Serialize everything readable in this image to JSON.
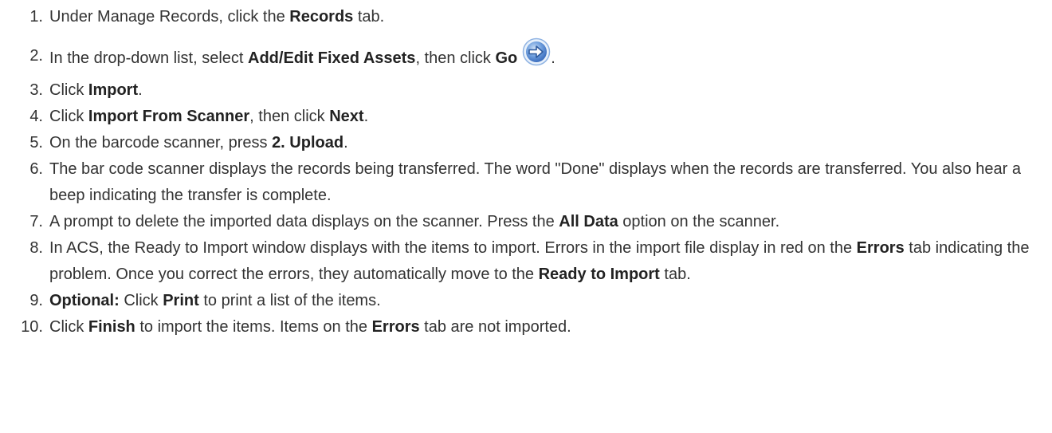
{
  "steps": [
    {
      "number": "1.",
      "parts": [
        "Under Manage Records, click the ",
        "Records",
        " tab."
      ]
    },
    {
      "number": "2.",
      "parts": [
        "In the drop-down list, select ",
        "Add/Edit Fixed Assets",
        ", then click ",
        "Go",
        "."
      ],
      "icon": "go-arrow-icon"
    },
    {
      "number": "3.",
      "parts": [
        "Click ",
        "Import",
        "."
      ]
    },
    {
      "number": "4.",
      "parts": [
        "Click ",
        "Import From Scanner",
        ", then click ",
        "Next",
        "."
      ]
    },
    {
      "number": "5.",
      "parts": [
        "On the barcode scanner, press ",
        "2. Upload",
        "."
      ]
    },
    {
      "number": "6.",
      "text": "The bar code scanner displays the records being transferred. The word \"Done\" displays when the records are transferred. You also hear a beep indicating the transfer is complete."
    },
    {
      "number": "7.",
      "parts": [
        "A prompt to delete the imported data displays on the scanner. Press the ",
        "All Data",
        " option on the scanner."
      ]
    },
    {
      "number": "8.",
      "parts": [
        "In ACS, the Ready to Import window displays with the items to import. Errors in the import file display in red on the ",
        "Errors",
        " tab indicating the problem. Once you correct the errors, they automatically move to the ",
        "Ready to Import",
        " tab."
      ]
    },
    {
      "number": "9.",
      "parts": [
        "Optional:",
        " Click ",
        "Print",
        " to print a list of the items."
      ]
    },
    {
      "number": "10.",
      "parts": [
        "Click ",
        "Finish",
        " to import the items. Items on the ",
        "Errors",
        " tab are not imported."
      ]
    }
  ],
  "colors": {
    "text": "#333333",
    "icon_fill": "#5b8ed6",
    "icon_ring": "#9fc0ea"
  }
}
